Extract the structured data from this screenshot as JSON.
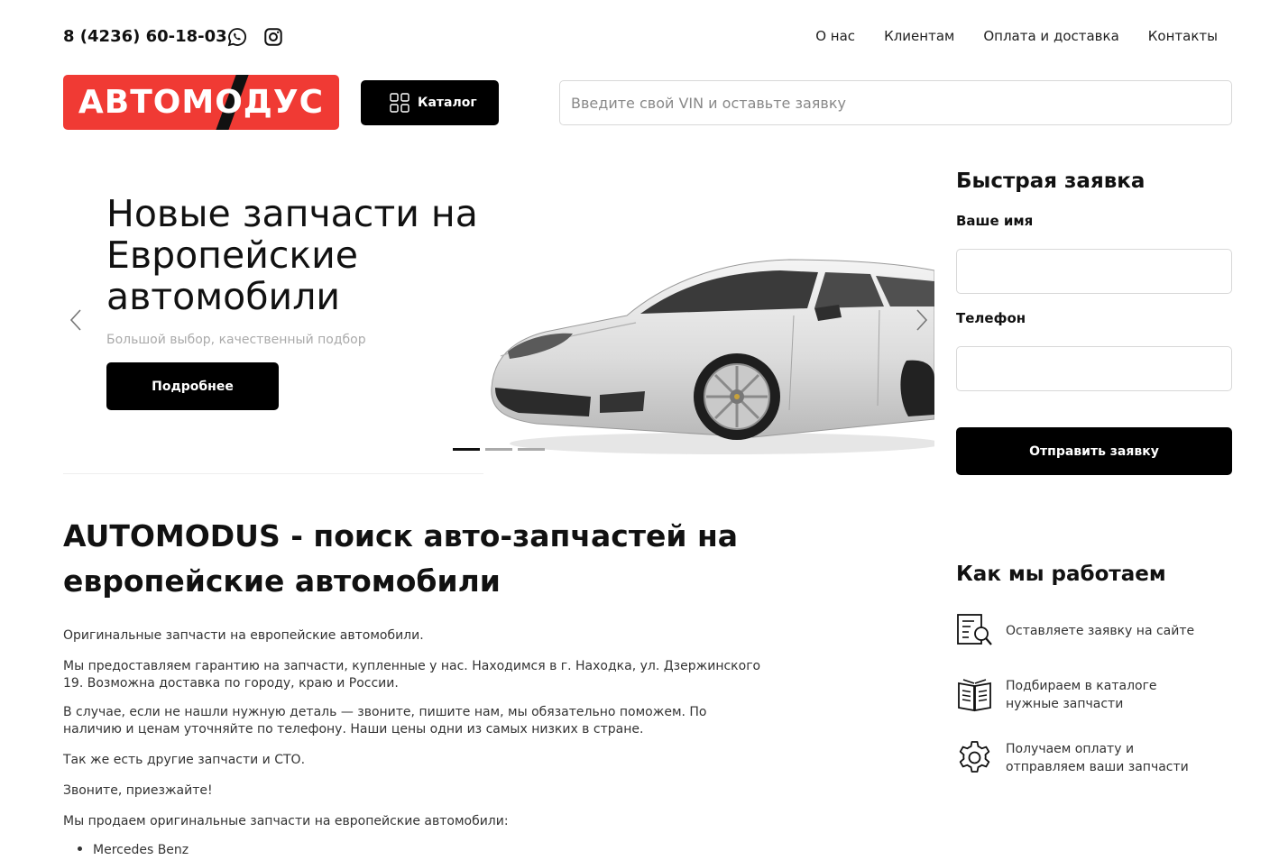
{
  "header": {
    "phone": "8 (4236) 60-18-03",
    "nav": [
      "О нас",
      "Клиентам",
      "Оплата и доставка",
      "Контакты"
    ]
  },
  "brand": {
    "logo_text": "АВТОМОДУС",
    "accent_color": "#f03a34"
  },
  "catalog_button": "Каталог",
  "vin_search": {
    "placeholder": "Введите свой VIN и оставьте заявку"
  },
  "slider": {
    "title": "Новые запчасти на Европейские автомобили",
    "subtitle": "Большой выбор, качественный подбор",
    "button": "Подробнее",
    "slides_count": 3,
    "active_slide": 1
  },
  "quick_request": {
    "title": "Быстрая заявка",
    "name_label": "Ваше имя",
    "phone_label": "Телефон",
    "submit": "Отправить заявку"
  },
  "main": {
    "title": "AUTOMODUS - поиск авто-запчастей на европейские автомобили",
    "paragraphs": [
      "Оригинальные запчасти на европейские автомобили.",
      "Мы предоставляем гарантию на запчасти, купленные у нас. Находимся в г. Находка, ул. Дзержинского 19. Возможна доставка по городу, краю и России.",
      "В случае, если не нашли нужную деталь — звоните, пишите нам, мы обязательно поможем. По наличию и ценам уточняйте по телефону. Наши цены одни из самых низких в стране.",
      "Так же есть другие запчасти и СТО.",
      "Звоните, приезжайте!",
      "Мы продаем оригинальные запчасти на европейские автомобили:"
    ],
    "brands": [
      "Mercedes Benz"
    ]
  },
  "how_we_work": {
    "title": "Как мы работаем",
    "steps": [
      {
        "icon": "form-search-icon",
        "text": "Оставляете заявку на сайте"
      },
      {
        "icon": "catalog-book-icon",
        "text": "Подбираем в каталоге нужные запчасти"
      },
      {
        "icon": "gear-icon",
        "text": "Получаем оплату и отправляем ваши запчасти"
      }
    ]
  }
}
